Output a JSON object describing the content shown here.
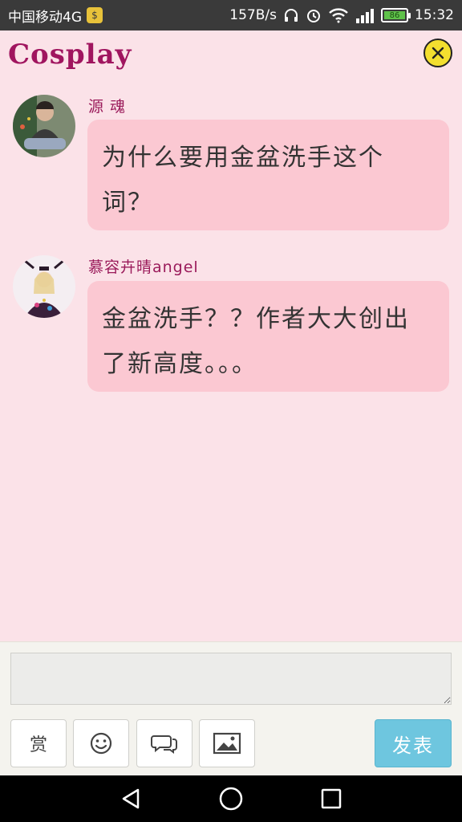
{
  "status_bar": {
    "carrier": "中国移动4G",
    "net_speed": "157B/s",
    "battery": "86",
    "time": "15:32"
  },
  "header": {
    "title": "Cosplay"
  },
  "messages": [
    {
      "author": "源 魂",
      "text": "为什么要用金盆洗手这个词？"
    },
    {
      "author": "慕容卉晴angel",
      "text": "金盆洗手？？作者大大创出了新高度。。。"
    }
  ],
  "composer": {
    "input_value": "",
    "reward_label": "赏",
    "send_label": "发表"
  },
  "icons": {
    "close": "close-icon",
    "emoji": "smiley-icon",
    "chat": "chat-bubbles-icon",
    "image": "image-icon"
  },
  "colors": {
    "background": "#fbe2e8",
    "bubble": "#fbc8d2",
    "accent": "#a0155f",
    "send_button": "#6ec6df"
  }
}
